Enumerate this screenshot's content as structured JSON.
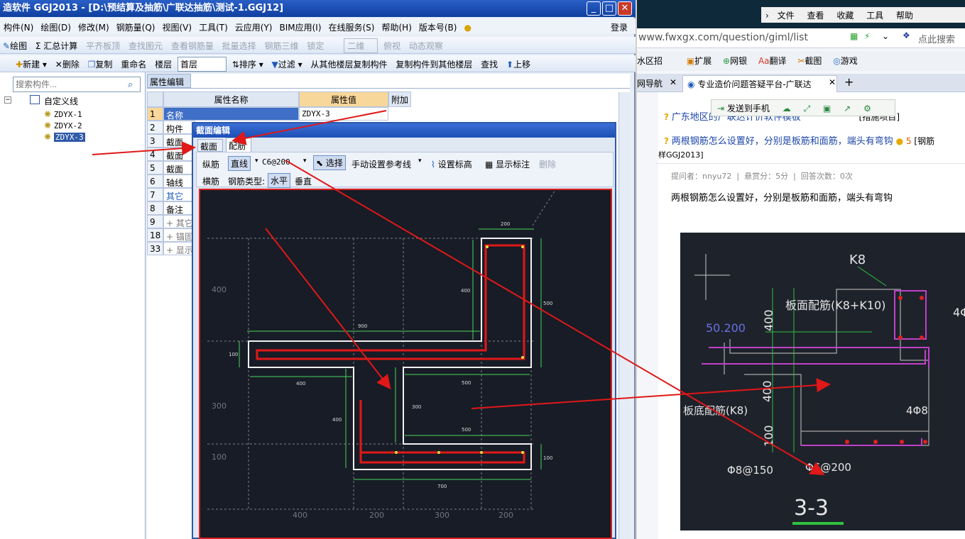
{
  "app": {
    "title": "造软件 GGJ2013 - [D:\\预结算及抽筋\\广联达抽筋\\测试-1.GGJ12]",
    "menu": [
      "构件(N)",
      "绘图(D)",
      "修改(M)",
      "钢筋量(Q)",
      "视图(V)",
      "工具(T)",
      "云应用(Y)",
      "BIM应用(I)",
      "在线服务(S)",
      "帮助(H)",
      "版本号(B)"
    ],
    "login": "登录",
    "toolbar1": {
      "draw": "绘图",
      "sum": "Σ 汇总计算",
      "flat": "平齐板顶",
      "find": "查找图元",
      "viewrebar": "查看钢筋量",
      "batch": "批量选择",
      "rebar3d": "钢筋三维",
      "lock": "锁定",
      "view2d": "二维",
      "topview": "俯视",
      "dynamic": "动态观察"
    },
    "toolbar2": {
      "new": "新建",
      "delete": "删除",
      "copy": "复制",
      "rename": "重命名",
      "floor_label": "楼层",
      "floor_value": "首层",
      "sort": "排序",
      "filter": "过滤",
      "copy_from": "从其他楼层复制构件",
      "copy_to": "复制构件到其他楼层",
      "search": "查找",
      "up": "上移"
    },
    "search_placeholder": "搜索构件...",
    "tree": {
      "root": "自定义线",
      "items": [
        "ZDYX-1",
        "ZDYX-2",
        "ZDYX-3"
      ],
      "selected": 2
    },
    "prop_tab": "属性编辑",
    "grid": {
      "headers": [
        "属性名称",
        "属性值",
        "附加"
      ],
      "rows": [
        {
          "n": "1",
          "name": "名称",
          "value": "ZDYX-3"
        },
        {
          "n": "2",
          "name": "构件",
          "value": ""
        },
        {
          "n": "3",
          "name": "截面",
          "value": ""
        },
        {
          "n": "4",
          "name": "截面",
          "value": ""
        },
        {
          "n": "5",
          "name": "截面",
          "value": ""
        },
        {
          "n": "6",
          "name": "轴线",
          "value": ""
        },
        {
          "n": "7",
          "name": "其它",
          "value": ""
        },
        {
          "n": "8",
          "name": "备注",
          "value": ""
        },
        {
          "n": "9",
          "name": "+ 其它",
          "value": ""
        },
        {
          "n": "18",
          "name": "+ 锚固",
          "value": ""
        },
        {
          "n": "33",
          "name": "+ 显示",
          "value": ""
        }
      ]
    }
  },
  "dialog": {
    "title": "截面编辑",
    "tabs": [
      "截面",
      "配筋"
    ],
    "active_tab": 1,
    "row1": {
      "long": "纵筋",
      "straight": "直线",
      "spec": "C6@200",
      "select": "选择",
      "manual": "手动设置参考线",
      "elev": "设置标高",
      "showdim": "显示标注",
      "del": "删除"
    },
    "row2": {
      "trans": "横筋",
      "type_label": "钢筋类型:",
      "horizontal": "水平",
      "vertical": "垂直"
    },
    "dims": {
      "d200": "200",
      "d400a": "400",
      "d500": "500",
      "d900": "900",
      "d100a": "100",
      "d400b": "400",
      "d500b": "500",
      "d300": "300",
      "d400c": "400",
      "d500c": "500",
      "d100b": "100",
      "d700": "700"
    },
    "axis_left": [
      "400",
      "300",
      "100"
    ],
    "axis_bottom": [
      "400",
      "200",
      "300",
      "200"
    ]
  },
  "browser": {
    "menu": [
      "文件",
      "查看",
      "收藏",
      "工具",
      "帮助"
    ],
    "url": "www.fwxgx.com/question/giml/list",
    "search_hint": "点此搜索",
    "ext": [
      "水区招",
      "扩展",
      "网银",
      "翻译",
      "截图",
      "游戏"
    ],
    "tabs": [
      "网导航",
      "专业造价问题答疑平台-广联达"
    ],
    "popup": "发送到手机",
    "q_prev": "广东地区的广联达计价软件模板",
    "q_prev_tag": "[措施项目]",
    "q_title": "两根钢筋怎么设置好，分别是板筋和面筋，端头有弯钩",
    "q_score": "5",
    "q_tag": "[钢筋",
    "q_tag2": "样GGJ2013]",
    "meta": {
      "asker": "提问者：nnyu72",
      "reward": "悬赏分：5分",
      "answers": "回答次数：0次"
    },
    "body": "两根钢筋怎么设置好，分别是板筋和面筋，端头有弯钩",
    "cad": {
      "k8": "K8",
      "top_label": "板面配筋(K8+K10)",
      "elev": "50.200",
      "bot_label": "板底配筋(K8)",
      "d400": "400",
      "d400b": "400",
      "d100": "100",
      "r1": "4Φ8",
      "r2": "Φ8@150",
      "r3": "Φ6@200",
      "section": "3-3",
      "right": "4Φ"
    }
  }
}
